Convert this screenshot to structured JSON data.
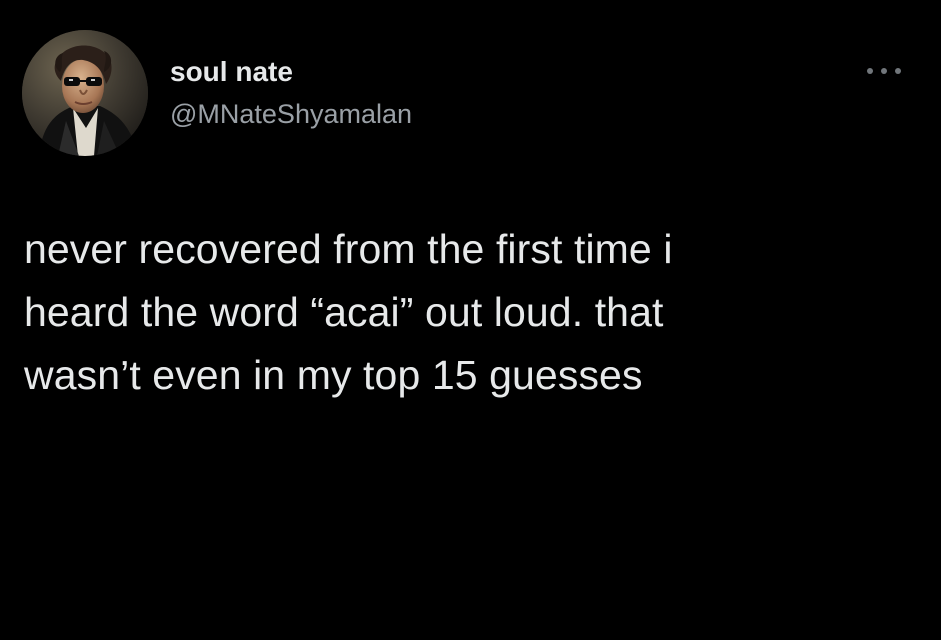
{
  "user": {
    "display_name": "soul nate",
    "handle": "@MNateShyamalan",
    "avatar_icon": "portrait-avatar-icon"
  },
  "menu": {
    "icon": "more-horizontal-icon"
  },
  "tweet": {
    "lines": [
      "never recovered from the first time i",
      "heard the word “acai” out loud. that",
      "wasn’t even in my top 15 guesses"
    ]
  },
  "colors": {
    "background": "#000000",
    "primary_text": "#e7e9ea",
    "secondary_text": "#9aa0a6"
  }
}
